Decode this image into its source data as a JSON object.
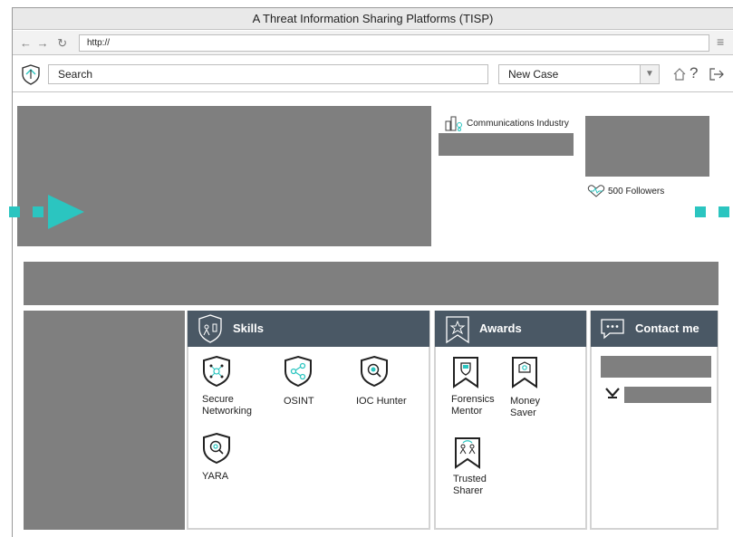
{
  "window": {
    "title": "A Threat Information Sharing Platforms (TISP)"
  },
  "browser": {
    "url": "http://"
  },
  "toolbar": {
    "search_placeholder": "Search",
    "case_select": "New Case"
  },
  "profile": {
    "industry": "Communications Industry",
    "followers": "500 Followers"
  },
  "skills": {
    "title": "Skills",
    "items": [
      {
        "label": "Secure Networking",
        "icon": "network-shield-icon"
      },
      {
        "label": "OSINT",
        "icon": "share-shield-icon"
      },
      {
        "label": "IOC Hunter",
        "icon": "magnifier-shield-icon"
      },
      {
        "label": "YARA",
        "icon": "yara-shield-icon"
      }
    ]
  },
  "awards": {
    "title": "Awards",
    "items": [
      {
        "label": "Forensics Mentor",
        "icon": "shield-ribbon-icon"
      },
      {
        "label": "Money Saver",
        "icon": "money-ribbon-icon"
      },
      {
        "label": "Trusted Sharer",
        "icon": "people-ribbon-icon"
      }
    ]
  },
  "contact": {
    "title": "Contact me"
  },
  "colors": {
    "header": "#4a5865",
    "placeholder": "#7f7f7f",
    "accent": "#2bc5c0"
  }
}
